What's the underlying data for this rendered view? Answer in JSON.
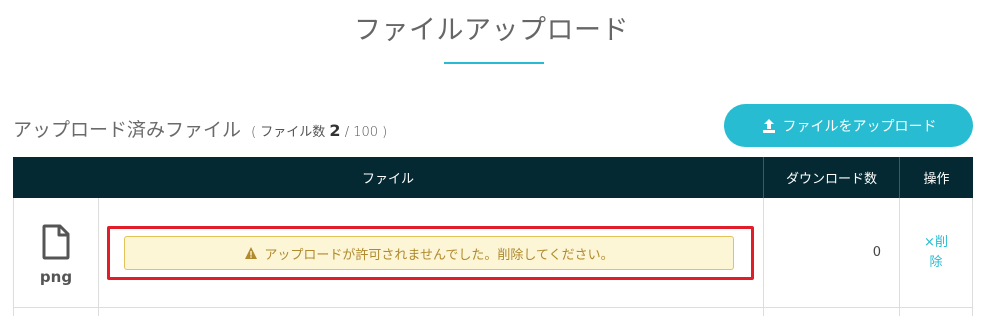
{
  "page": {
    "title": "ファイルアップロード"
  },
  "section": {
    "heading": "アップロード済みファイル",
    "count_open": "( ファイル数",
    "count_current": "2",
    "count_sep": "/ 100",
    "count_close": ")"
  },
  "upload_button": {
    "label": "ファイルをアップロード",
    "icon": "upload-icon"
  },
  "table": {
    "headers": {
      "file": "ファイル",
      "downloads": "ダウンロード数",
      "actions": "操作"
    },
    "rows": [
      {
        "icon": "file-icon",
        "ext": "png",
        "alert": "アップロードが許可されませんでした。削除してください。",
        "alert_icon": "warning-icon",
        "downloads": "0",
        "delete_label": "×削除"
      }
    ]
  },
  "colors": {
    "accent": "#27bcd1",
    "header_bg": "#052932",
    "alert_bg": "#fcf5d6",
    "alert_border": "#e2c35b",
    "highlight_frame": "#e11d2a"
  }
}
